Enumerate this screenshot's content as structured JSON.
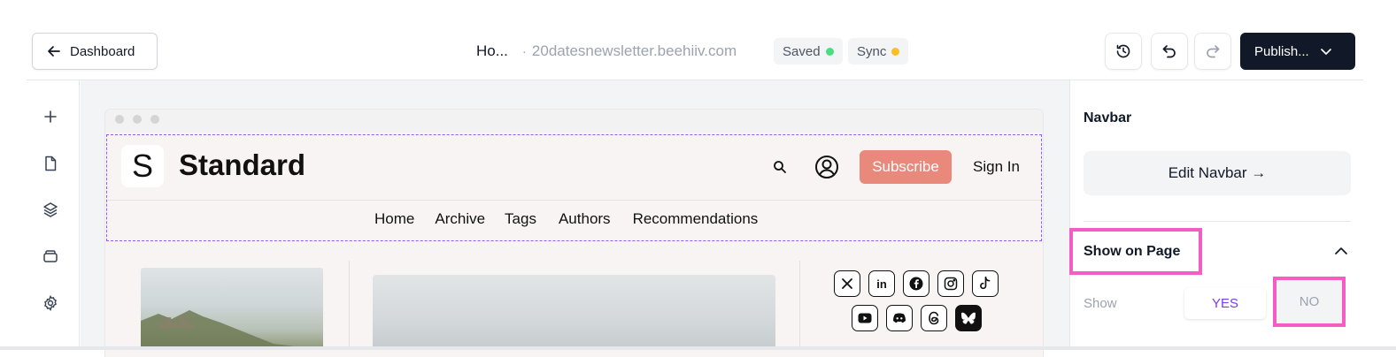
{
  "header": {
    "back_label": "Dashboard",
    "doc_title": "Ho...",
    "separator": "·",
    "domain": "20datesnewsletter.beehiiv.com",
    "saved_label": "Saved",
    "saved_color": "#4ade80",
    "sync_label": "Sync",
    "sync_color": "#fbbf24",
    "publish_label": "Publish..."
  },
  "rail": {
    "items": [
      "plus-icon",
      "page-icon",
      "layers-icon",
      "archive-icon",
      "settings-icon"
    ]
  },
  "preview": {
    "logo_letter": "S",
    "brand_name": "Standard",
    "subscribe_label": "Subscribe",
    "signin_label": "Sign In",
    "nav_links": [
      "Home",
      "Archive",
      "Tags",
      "Authors",
      "Recommendations"
    ],
    "social_icons": [
      "x-icon",
      "linkedin-icon",
      "facebook-icon",
      "instagram-icon",
      "tiktok-icon",
      "youtube-icon",
      "discord-icon",
      "threads-icon",
      "bluesky-icon"
    ]
  },
  "panel": {
    "title": "Navbar",
    "edit_button": "Edit Navbar →",
    "section_title": "Show on Page",
    "show_label": "Show",
    "yes_label": "YES",
    "no_label": "NO"
  },
  "colors": {
    "accent": "#7c3aed",
    "highlight": "#f45ec4",
    "subscribe": "#e8897c",
    "publish_bg": "#111827"
  }
}
